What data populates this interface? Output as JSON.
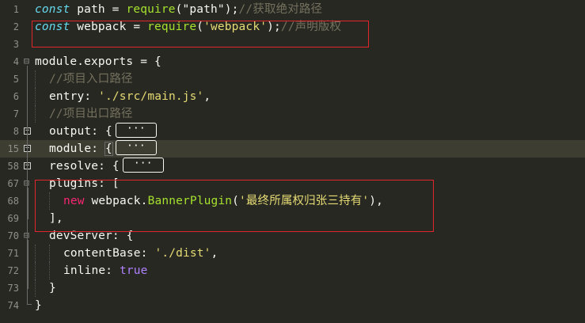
{
  "editor": {
    "theme_colors": {
      "background": "#272822",
      "keyword": "#66d9ef",
      "function": "#a6e22e",
      "string": "#e6db74",
      "comment": "#75715e",
      "new_keyword": "#f92672",
      "boolean": "#ae81ff",
      "highlight_box": "#e0252b"
    },
    "line_numbers": [
      "1",
      "2",
      "3",
      "4",
      "5",
      "6",
      "7",
      "8",
      "15",
      "58",
      "67",
      "68",
      "69",
      "70",
      "71",
      "72",
      "73",
      "74"
    ],
    "lines": {
      "l1": {
        "kw": "const",
        "a": " path = ",
        "fn": "require",
        "b": "(\"path\");",
        "cm": "//获取绝对路径"
      },
      "l2": {
        "kw": "const",
        "a": " webpack = ",
        "fn": "require",
        "b": "(",
        "str": "'webpack'",
        "c": ");",
        "cm": "//声明版权"
      },
      "l4": {
        "a": "module.exports = {"
      },
      "l5": {
        "cm": "//项目入口路径"
      },
      "l6": {
        "a": "entry: ",
        "str": "'./src/main.js'",
        "b": ","
      },
      "l7": {
        "cm": "//项目出口路径"
      },
      "l8": {
        "a": "output: {",
        "ellipsis": "···"
      },
      "l15": {
        "a": "module: ",
        "b": "{",
        "ellipsis": "···"
      },
      "l58": {
        "a": "resolve: {",
        "ellipsis": "···"
      },
      "l67": {
        "a": "plugins: ["
      },
      "l68": {
        "kw": "new",
        "a": " webpack.",
        "fn": "BannerPlugin",
        "b": "(",
        "str": "'最终所属权归张三持有'",
        "c": "),"
      },
      "l69": {
        "a": "],"
      },
      "l70": {
        "a": "devServer: {"
      },
      "l71": {
        "a": "contentBase: ",
        "str": "'./dist'",
        "b": ","
      },
      "l72": {
        "a": "inline: ",
        "bool": "true"
      },
      "l73": {
        "a": "}"
      },
      "l74": {
        "a": "}"
      }
    }
  }
}
